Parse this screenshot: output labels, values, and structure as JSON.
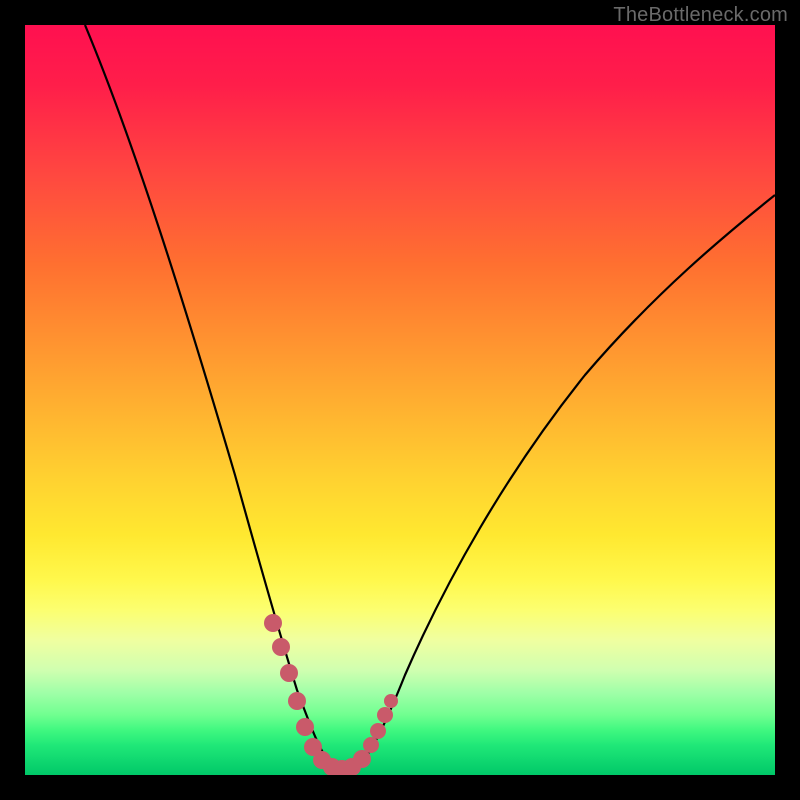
{
  "watermark": "TheBottleneck.com",
  "chart_data": {
    "type": "line",
    "title": "",
    "xlabel": "",
    "ylabel": "",
    "xlim": [
      0,
      100
    ],
    "ylim": [
      0,
      100
    ],
    "series": [
      {
        "name": "bottleneck-curve",
        "x": [
          8,
          12,
          16,
          20,
          24,
          28,
          31,
          33,
          35,
          37,
          38,
          39,
          40,
          42,
          44,
          46,
          48,
          52,
          58,
          65,
          74,
          84,
          94,
          100
        ],
        "values": [
          100,
          90,
          78,
          66,
          54,
          40,
          27,
          19,
          12,
          6,
          3,
          1,
          0,
          0,
          1,
          3,
          7,
          14,
          24,
          34,
          44,
          54,
          62,
          66
        ]
      }
    ],
    "highlight": {
      "name": "optimal-region",
      "points": [
        {
          "x": 32.5,
          "y": 20
        },
        {
          "x": 33.8,
          "y": 14
        },
        {
          "x": 35.0,
          "y": 9
        },
        {
          "x": 36.5,
          "y": 5
        },
        {
          "x": 38.0,
          "y": 2
        },
        {
          "x": 39.0,
          "y": 1
        },
        {
          "x": 40.0,
          "y": 0.5
        },
        {
          "x": 41.5,
          "y": 0.5
        },
        {
          "x": 43.0,
          "y": 0.7
        },
        {
          "x": 44.5,
          "y": 2
        },
        {
          "x": 45.8,
          "y": 4
        },
        {
          "x": 47.0,
          "y": 6
        },
        {
          "x": 47.8,
          "y": 8
        },
        {
          "x": 48.5,
          "y": 10
        }
      ],
      "color": "#c95a6a"
    },
    "background_gradient": {
      "top": "#ff1050",
      "mid": "#ffe830",
      "bottom": "#00c868"
    }
  }
}
